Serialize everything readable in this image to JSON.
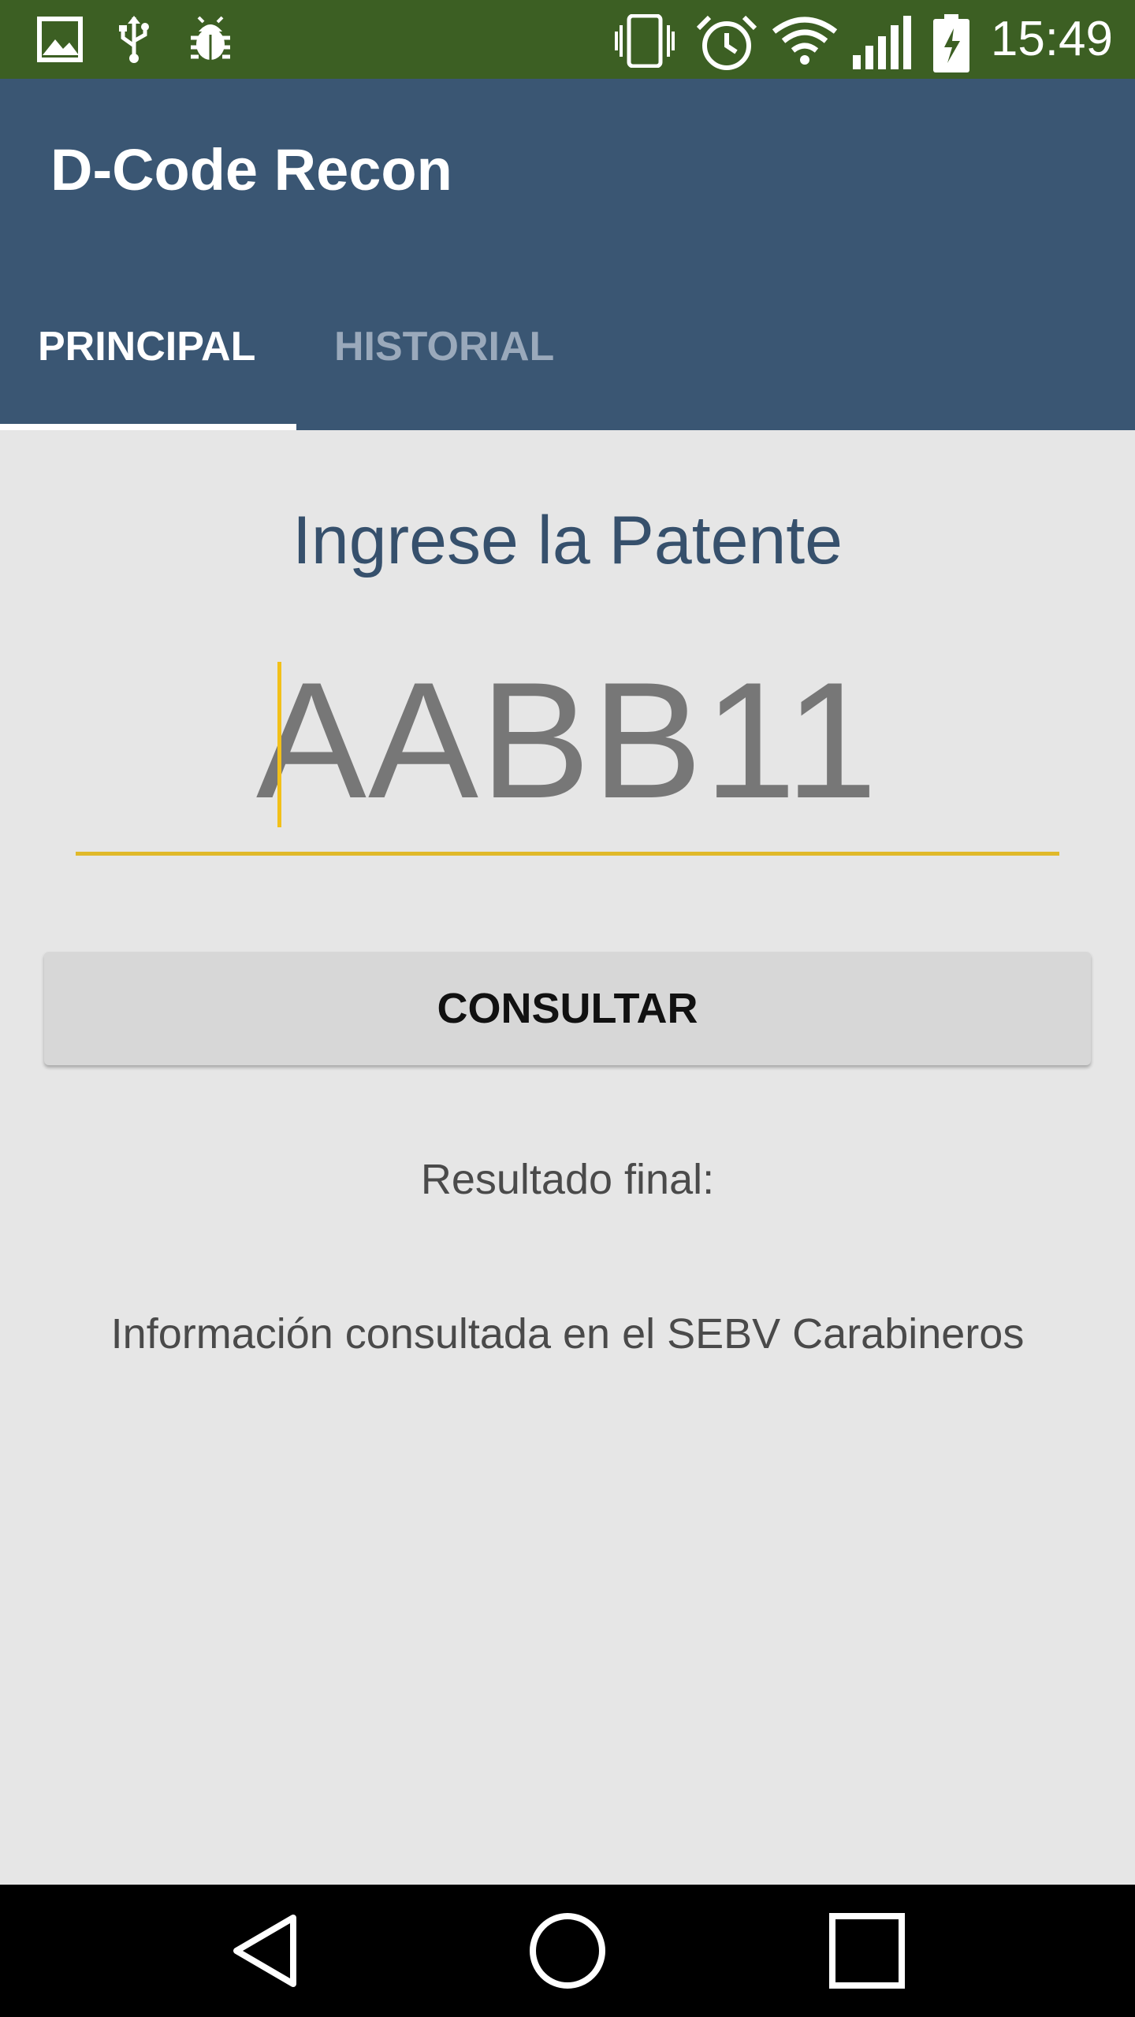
{
  "status_bar": {
    "time": "15:49",
    "left_icons": [
      "image-icon",
      "usb-icon",
      "debug-bug-icon"
    ],
    "right_icons": [
      "vibrate-icon",
      "alarm-icon",
      "wifi-icon",
      "signal-icon",
      "battery-charging-icon"
    ],
    "background": "#3c5f23"
  },
  "app_bar": {
    "title": "D-Code Recon",
    "background": "#3a5673"
  },
  "tabs": [
    {
      "label": "PRINCIPAL",
      "selected": true
    },
    {
      "label": "HISTORIAL",
      "selected": false
    }
  ],
  "main": {
    "prompt": "Ingrese la Patente",
    "plate_value": "AABB11",
    "consult_button": "CONSULTAR",
    "result_label": "Resultado final:",
    "info_text": "Información consultada en el SEBV Carabineros"
  },
  "nav_bar": {
    "buttons": [
      "back-icon",
      "home-icon",
      "recents-icon"
    ]
  },
  "colors": {
    "accent": "#e0b92a",
    "title_text": "#36506c",
    "content_background": "#e6e6e6"
  }
}
